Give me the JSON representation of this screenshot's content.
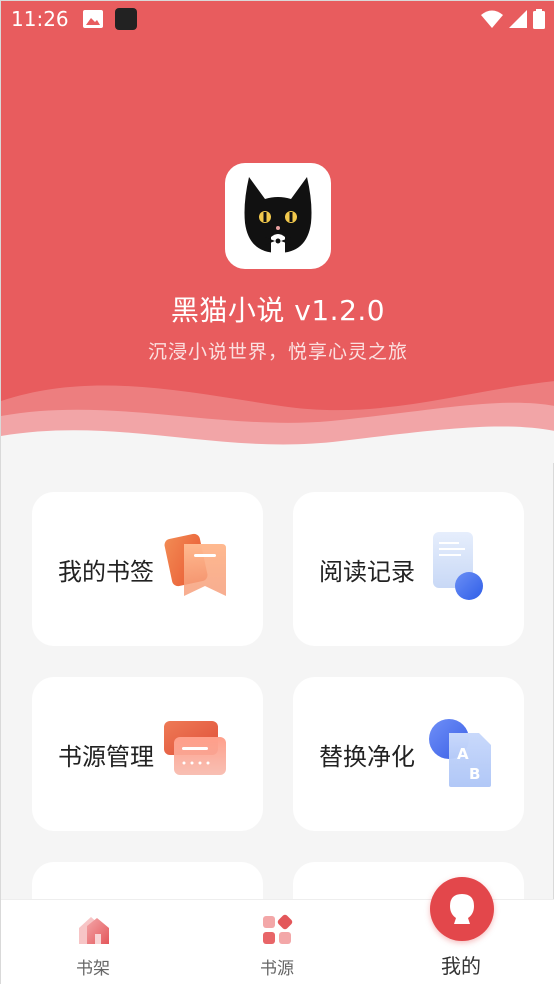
{
  "status_bar": {
    "time": "11:26"
  },
  "header": {
    "app_title": "黑猫小说 v1.2.0",
    "slogan": "沉浸小说世界，悦享心灵之旅"
  },
  "menu": {
    "bookmarks": "我的书签",
    "reading_history": "阅读记录",
    "source_management": "书源管理",
    "replace_purify": "替换净化"
  },
  "bottom_nav": {
    "items": [
      {
        "label": "书架",
        "icon": "house-icon",
        "active": false
      },
      {
        "label": "书源",
        "icon": "grid-icon",
        "active": false
      },
      {
        "label": "我的",
        "icon": "profile-icon",
        "active": true
      }
    ]
  },
  "colors": {
    "accent": "#e85c5e",
    "active_tab": "#e3474b",
    "card_background": "#ffffff",
    "page_background": "#f5f5f5"
  }
}
